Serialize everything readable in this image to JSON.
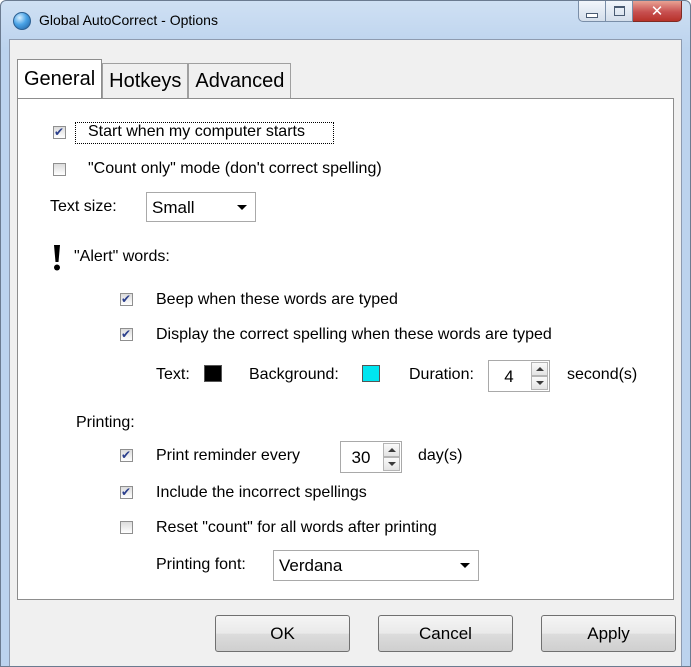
{
  "window": {
    "title": "Global AutoCorrect - Options",
    "icon": "globe-icon",
    "controls": {
      "minimize": "minimize-icon",
      "maximize": "maximize-icon",
      "close": "close-icon"
    }
  },
  "tabs": [
    {
      "label": "General",
      "active": true
    },
    {
      "label": "Hotkeys",
      "active": false
    },
    {
      "label": "Advanced",
      "active": false
    }
  ],
  "general": {
    "start_with_computer": {
      "label": "Start when my computer starts",
      "checked": true
    },
    "count_only": {
      "label": "\"Count only\" mode (don't correct spelling)",
      "checked": false
    },
    "text_size": {
      "label": "Text size:",
      "value": "Small"
    },
    "alert_words": {
      "icon": "exclamation-icon",
      "heading": "\"Alert\" words:",
      "beep": {
        "label": "Beep when these words are typed",
        "checked": true
      },
      "display_correct": {
        "label": "Display the correct spelling when these words are typed",
        "checked": true
      },
      "text_color": {
        "label": "Text:",
        "color": "#000000"
      },
      "background_color": {
        "label": "Background:",
        "color": "#00e5f0"
      },
      "duration": {
        "label": "Duration:",
        "value": "4",
        "unit": "second(s)"
      }
    },
    "printing": {
      "heading": "Printing:",
      "reminder": {
        "label": "Print reminder every",
        "value": "30",
        "unit": "day(s)",
        "checked": true
      },
      "include_incorrect": {
        "label": "Include the incorrect spellings",
        "checked": true
      },
      "reset_count": {
        "label": "Reset \"count\" for all words after printing",
        "checked": false
      },
      "font": {
        "label": "Printing font:",
        "value": "Verdana"
      }
    }
  },
  "buttons": {
    "ok": "OK",
    "cancel": "Cancel",
    "apply": "Apply"
  }
}
